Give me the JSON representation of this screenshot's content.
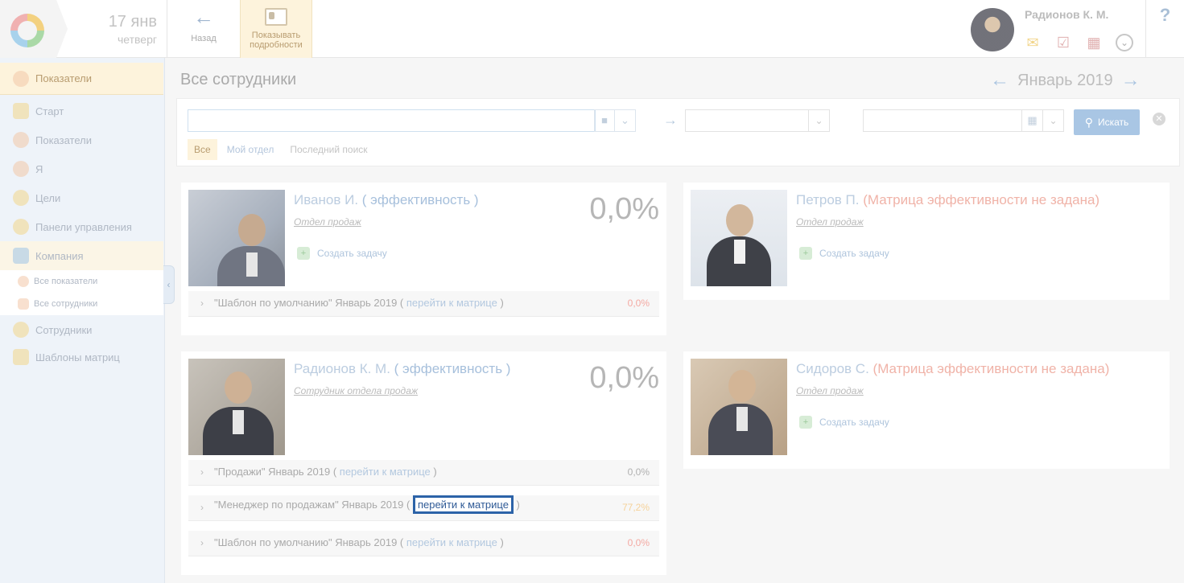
{
  "header": {
    "date_day": "17 янв",
    "date_weekday": "четверг",
    "back_label": "Назад",
    "details_label_1": "Показывать",
    "details_label_2": "подробности",
    "user_name": "Радионов К. М.",
    "help": "?"
  },
  "sidebar": {
    "top": "Показатели",
    "items": [
      {
        "label": "Старт"
      },
      {
        "label": "Показатели"
      },
      {
        "label": "Я"
      },
      {
        "label": "Цели"
      },
      {
        "label": "Панели управления"
      },
      {
        "label": "Компания"
      },
      {
        "label": "Все показатели"
      },
      {
        "label": "Все сотрудники"
      },
      {
        "label": "Сотрудники"
      },
      {
        "label": "Шаблоны матриц"
      }
    ]
  },
  "main": {
    "title": "Все сотрудники",
    "month": "Январь 2019"
  },
  "filter": {
    "search_value": "",
    "search_button": "Искать",
    "tabs": [
      "Все",
      "Мой отдел",
      "Последний поиск"
    ]
  },
  "cards": [
    {
      "name": "Иванов И.",
      "eff_open": " ( ",
      "eff_label": "эффективность",
      "eff_close": " )",
      "dept": "Отдел продаж",
      "task": "Создать задачу",
      "percent": "0,0%",
      "matrices": [
        {
          "title": "\"Шаблон по умолчанию\" Январь 2019 ( ",
          "link": "перейти к матрице",
          "close": " )",
          "value": "0,0%"
        }
      ]
    },
    {
      "name": "Петров П.",
      "warning": " (Матрица эффективности не задана)",
      "dept": "Отдел продаж",
      "task": "Создать задачу"
    },
    {
      "name": "Радионов К. М.",
      "eff_open": " ( ",
      "eff_label": "эффективность",
      "eff_close": " )",
      "dept": "Сотрудник отдела продаж",
      "percent": "0,0%",
      "matrices": [
        {
          "title": "\"Продажи\" Январь 2019 ( ",
          "link": "перейти к матрице",
          "close": " )",
          "value": "0,0%"
        },
        {
          "title": "\"Менеджер по продажам\" Январь 2019 ( ",
          "link": "перейти к матрице",
          "close": " )",
          "value": "77,2%"
        },
        {
          "title": "\"Шаблон по умолчанию\" Январь 2019 ( ",
          "link": "перейти к матрице",
          "close": " )",
          "value": "0,0%"
        }
      ]
    },
    {
      "name": "Сидоров С.",
      "warning": " (Матрица эффективности не задана)",
      "dept": "Отдел продаж",
      "task": "Создать задачу"
    }
  ],
  "colors": {
    "accent": "#2c63a8",
    "highlight_bg": "#fdf3dc",
    "warning_text": "#f0b3a8"
  }
}
